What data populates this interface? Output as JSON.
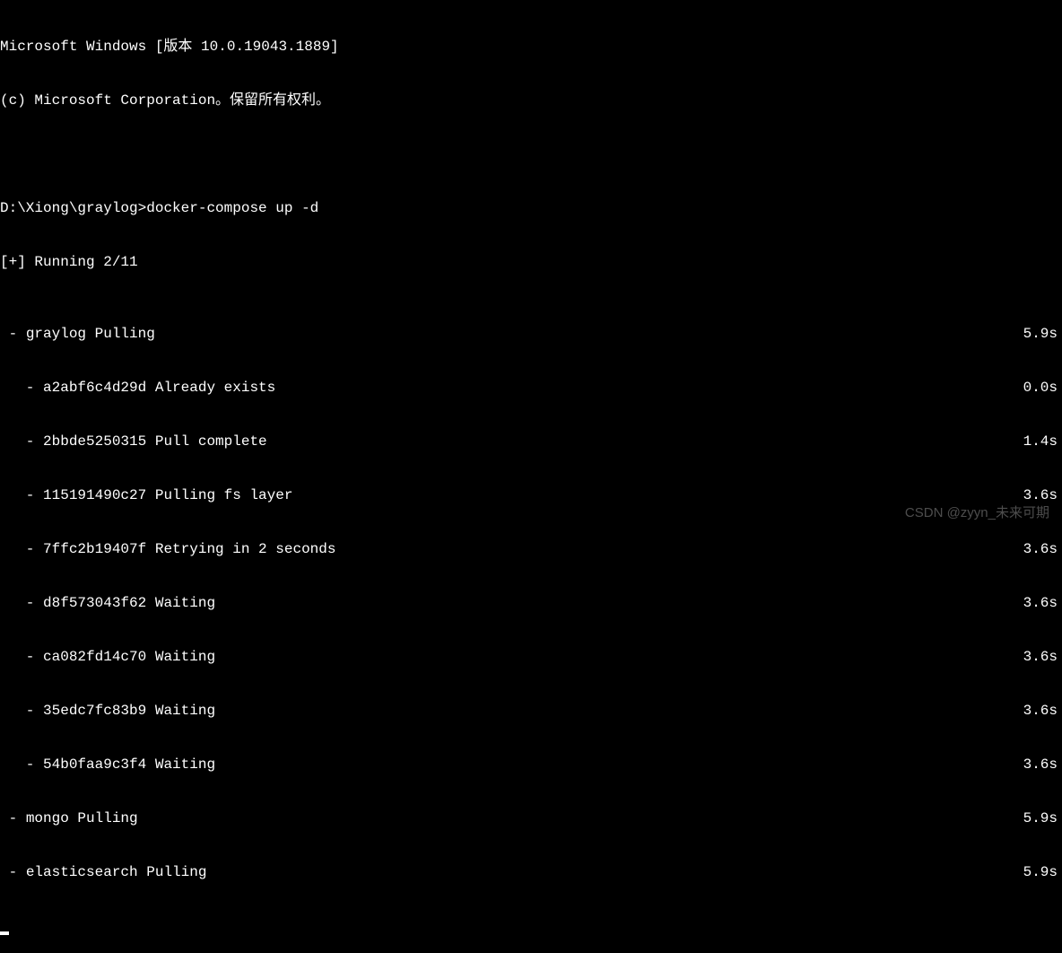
{
  "header": {
    "line1": "Microsoft Windows [版本 10.0.19043.1889]",
    "line2": "(c) Microsoft Corporation。保留所有权利。"
  },
  "prompt": {
    "path": "D:\\Xiong\\graylog>",
    "command": "docker-compose up -d"
  },
  "status": {
    "running": "[+] Running 2/11"
  },
  "output": [
    {
      "indent": " - ",
      "text": "graylog Pulling",
      "time": "5.9s"
    },
    {
      "indent": "   - ",
      "text": "a2abf6c4d29d Already exists",
      "time": "0.0s"
    },
    {
      "indent": "   - ",
      "text": "2bbde5250315 Pull complete",
      "time": "1.4s"
    },
    {
      "indent": "   - ",
      "text": "115191490c27 Pulling fs layer",
      "time": "3.6s"
    },
    {
      "indent": "   - ",
      "text": "7ffc2b19407f Retrying in 2 seconds",
      "time": "3.6s"
    },
    {
      "indent": "   - ",
      "text": "d8f573043f62 Waiting",
      "time": "3.6s"
    },
    {
      "indent": "   - ",
      "text": "ca082fd14c70 Waiting",
      "time": "3.6s"
    },
    {
      "indent": "   - ",
      "text": "35edc7fc83b9 Waiting",
      "time": "3.6s"
    },
    {
      "indent": "   - ",
      "text": "54b0faa9c3f4 Waiting",
      "time": "3.6s"
    },
    {
      "indent": " - ",
      "text": "mongo Pulling",
      "time": "5.9s"
    },
    {
      "indent": " - ",
      "text": "elasticsearch Pulling",
      "time": "5.9s"
    }
  ],
  "watermark": "CSDN @zyyn_未来可期"
}
